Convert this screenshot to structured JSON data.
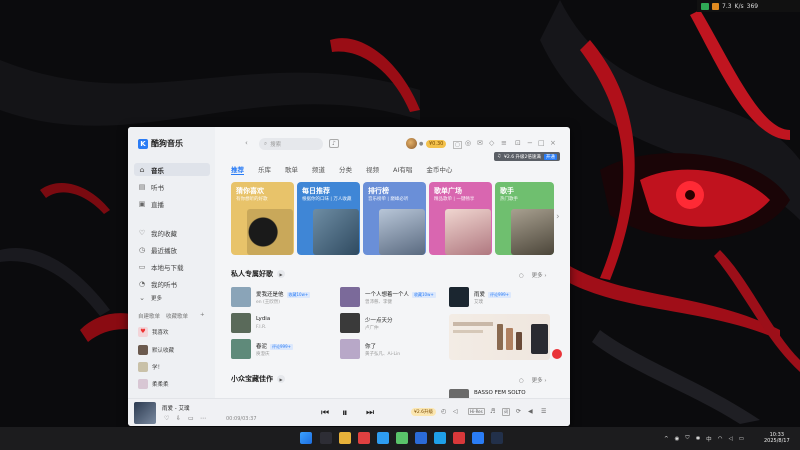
{
  "tray_top": {
    "speed1": "7.3",
    "speed_unit": "K/s",
    "speed2": "369"
  },
  "app": {
    "name": "酷狗音乐",
    "sidebar": {
      "main": [
        {
          "label": "音乐",
          "icon": "home-icon"
        },
        {
          "label": "听书",
          "icon": "book-icon"
        },
        {
          "label": "直播",
          "icon": "live-icon"
        }
      ],
      "lib": [
        {
          "label": "我的收藏",
          "icon": "heart-icon"
        },
        {
          "label": "最近播放",
          "icon": "clock-icon"
        },
        {
          "label": "本地与下载",
          "icon": "download-icon"
        },
        {
          "label": "我的听书",
          "icon": "listen-icon"
        },
        {
          "label": "更多",
          "icon": "chevron-down-icon"
        }
      ],
      "playlist_tabs": [
        "自建歌单",
        "收藏歌单"
      ],
      "playlists": [
        {
          "label": "我喜欢",
          "color": "#f3d4d8"
        },
        {
          "label": "默认收藏",
          "color": "#6b5a4e"
        },
        {
          "label": "学！",
          "color": "#c9c1a8"
        },
        {
          "label": "柔柔柔",
          "color": "#d8c7d4"
        }
      ]
    },
    "topbar": {
      "search_placeholder": "搜索",
      "vip_label": "¥0.30",
      "tip_text": "¥2.6 升级2倍速满",
      "tip_button": "开通"
    },
    "tabs": [
      "推荐",
      "乐库",
      "歌单",
      "频道",
      "分类",
      "视频",
      "AI有唱",
      "金币中心"
    ],
    "cards": [
      {
        "title": "猜你喜欢",
        "sub": "有你想听的好歌",
        "bg": "#e8c36a",
        "art": "#c9a85a"
      },
      {
        "title": "每日推荐",
        "sub": "根据你的口味 | 万人收藏",
        "bg": "#3f86d6",
        "art": "#4b6f8a"
      },
      {
        "title": "排行榜",
        "sub": "音乐榜单 | 巅峰必听",
        "bg": "#6a8fd8",
        "art": "#8a9fb8"
      },
      {
        "title": "歌单广场",
        "sub": "精品歌单 | 一键畅享",
        "bg": "#d966b0",
        "art": "#d9a3a8"
      },
      {
        "title": "歌手",
        "sub": "热门歌手",
        "bg": "#6fbf6f",
        "art": "#7a7060"
      }
    ],
    "section1": {
      "title": "私人专属好歌",
      "more": "更多",
      "songs": [
        {
          "name": "爱我还是他",
          "artist": "en (王欣然)",
          "badge": "收藏10w+",
          "color": "#8aa4b8"
        },
        {
          "name": "一个人想着一个人",
          "artist": "曾沛慈、李健",
          "badge": "收藏10w+",
          "color": "#7b6a9a"
        },
        {
          "name": "雨爱",
          "artist": "艾璞",
          "badge": "评论999+",
          "color": "#1b2630"
        },
        {
          "name": "Lydia",
          "artist": "F.I.R.",
          "badge": "",
          "color": "#5a6a5a"
        },
        {
          "name": "少一点天分",
          "artist": "卢广仲",
          "badge": "",
          "color": "#3a3a3a"
        },
        {
          "name": "春泥",
          "artist": "庾澄庆",
          "badge": "评论999+",
          "color": "#5f8a7a"
        },
        {
          "name": "你了",
          "artist": "黄子弘凡、Ai-Lin",
          "badge": "",
          "color": "#b8a8c8"
        }
      ]
    },
    "section2": {
      "title": "小众宝藏佳作",
      "more": "更多",
      "songs": [
        {
          "name": "BASSO FEM SOLTO",
          "color": "#6a6a6a"
        }
      ]
    },
    "player": {
      "title": "雨爱 - 艾璞",
      "time": "00:09/03:37",
      "coupon": "¥2.6升级",
      "quality": "Hi-Res",
      "cover_color": "#3a4a60"
    }
  },
  "clock": {
    "time": "10:33",
    "date": "2025/8/17"
  }
}
